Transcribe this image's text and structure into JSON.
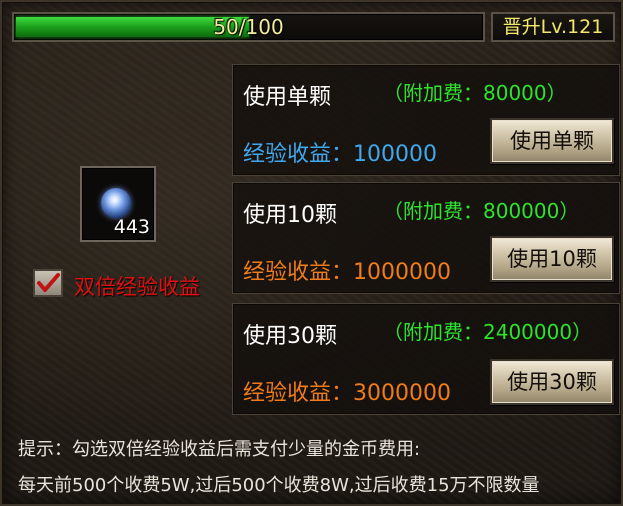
{
  "progress": {
    "current": 50,
    "max": 100,
    "text": "50/100",
    "fill_fraction": 0.5
  },
  "level": {
    "text": "晋升Lv.121"
  },
  "item": {
    "count": "443"
  },
  "double_exp": {
    "checked": true,
    "label": "双倍经验收益"
  },
  "options": [
    {
      "title": "使用单颗",
      "fee": "（附加费：80000）",
      "gain_label": "经验收益：",
      "gain_value": "100000",
      "gain_color": "#3fa8ee",
      "button": "使用单颗"
    },
    {
      "title": "使用10颗",
      "fee": "（附加费：800000）",
      "gain_label": "经验收益：",
      "gain_value": "1000000",
      "gain_color": "#f07c1a",
      "button": "使用10颗"
    },
    {
      "title": "使用30颗",
      "fee": "（附加费：2400000）",
      "gain_label": "经验收益：",
      "gain_value": "3000000",
      "gain_color": "#f07c1a",
      "button": "使用30颗"
    }
  ],
  "hint": {
    "line1": "提示：勾选双倍经验收益后需支付少量的金币费用:",
    "line2": "每天前500个收费5W,过后500个收费8W,过后收费15万不限数量"
  },
  "colors": {
    "fee_green": "#2ee22e",
    "checkbox_label_red": "#e01010",
    "level_yellow": "#f4e96a"
  }
}
